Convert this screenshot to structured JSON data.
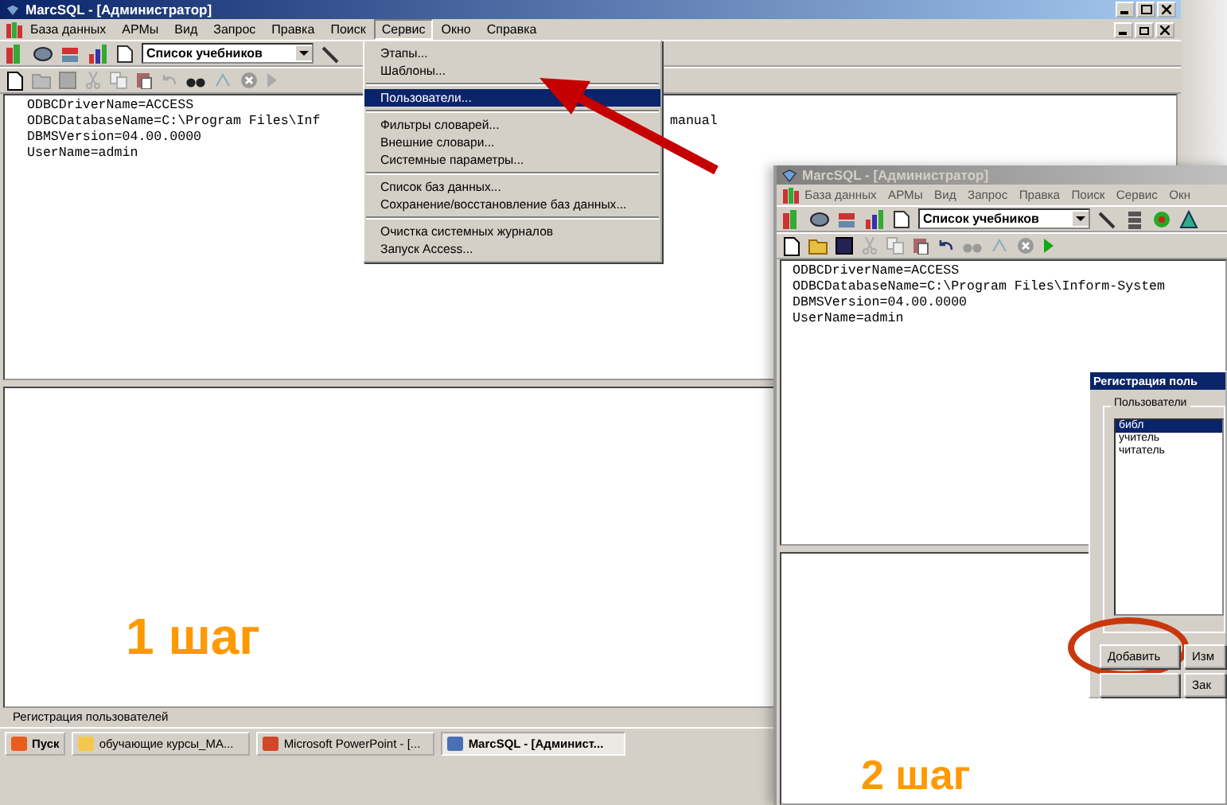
{
  "screen_1": {
    "window_title": "MarcSQL - [Администратор]",
    "active": true,
    "menu": [
      {
        "label": "База данных",
        "selected": false
      },
      {
        "label": "АРМы",
        "selected": false
      },
      {
        "label": "Вид",
        "selected": false
      },
      {
        "label": "Запрос",
        "selected": false
      },
      {
        "label": "Правка",
        "selected": false
      },
      {
        "label": "Поиск",
        "selected": false
      },
      {
        "label": "Сервис",
        "selected": true
      },
      {
        "label": "Окно",
        "selected": false
      },
      {
        "label": "Справка",
        "selected": false
      }
    ],
    "toolbar_combo": "Список учебников",
    "text_lines": [
      "ODBCDriverName=ACCESS",
      "ODBCDatabaseName=C:\\Program Files\\Inf",
      "DBMSVersion=04.00.0000",
      "UserName=admin"
    ],
    "text_line_tail": "manual",
    "step_label": "1 шаг",
    "status_bar": "Регистрация пользователей",
    "taskbar": [
      {
        "label": "Пуск",
        "kind": "start",
        "selected": false
      },
      {
        "label": "обучающие курсы_МА...",
        "kind": "folder",
        "selected": false
      },
      {
        "label": "Microsoft PowerPoint - [...",
        "kind": "slides",
        "selected": false
      },
      {
        "label": "MarcSQL - [Админист...",
        "kind": "app",
        "selected": true
      }
    ]
  },
  "dropdown_menu": {
    "groups": [
      [
        {
          "label": "Этапы...",
          "selected": false
        },
        {
          "label": "Шаблоны...",
          "selected": false
        }
      ],
      [
        {
          "label": "Пользователи...",
          "selected": true
        }
      ],
      [
        {
          "label": "Фильтры словарей...",
          "selected": false
        },
        {
          "label": "Внешние словари...",
          "selected": false
        },
        {
          "label": "Системные параметры...",
          "selected": false
        }
      ],
      [
        {
          "label": "Список баз данных...",
          "selected": false
        },
        {
          "label": "Сохранение/восстановление баз данных...",
          "selected": false
        }
      ],
      [
        {
          "label": "Очистка системных журналов",
          "selected": false
        },
        {
          "label": "Запуск Access...",
          "selected": false
        }
      ]
    ]
  },
  "screen_2": {
    "window_title": "MarcSQL - [Администратор]",
    "active": false,
    "menu": [
      {
        "label": "База данных",
        "selected": false
      },
      {
        "label": "АРМы",
        "selected": false
      },
      {
        "label": "Вид",
        "selected": false
      },
      {
        "label": "Запрос",
        "selected": false
      },
      {
        "label": "Правка",
        "selected": false
      },
      {
        "label": "Поиск",
        "selected": false
      },
      {
        "label": "Сервис",
        "selected": false
      },
      {
        "label": "Окн",
        "selected": false
      }
    ],
    "toolbar_combo": "Список учебников",
    "text_lines": [
      "ODBCDriverName=ACCESS",
      "ODBCDatabaseName=C:\\Program Files\\Inform-System",
      "DBMSVersion=04.00.0000",
      "UserName=admin"
    ],
    "step_label": "2 шаг",
    "dialog": {
      "title": "Регистрация поль",
      "group_label": "Пользователи",
      "users": [
        {
          "label": "библ",
          "selected": true
        },
        {
          "label": "учитель",
          "selected": false
        },
        {
          "label": "читатель",
          "selected": false
        }
      ],
      "buttons_row_1": [
        "Добавить",
        "Изм"
      ],
      "buttons_row_2": [
        "Зак"
      ]
    }
  }
}
